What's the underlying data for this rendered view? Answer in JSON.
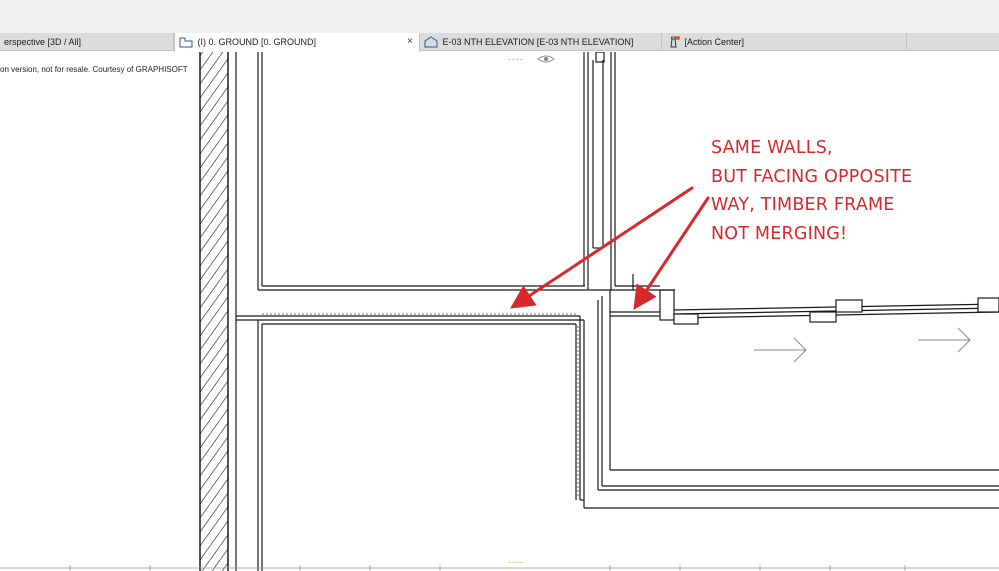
{
  "tabs": [
    {
      "label": "erspective [3D / All]",
      "icon": "perspective-icon",
      "active": false
    },
    {
      "label": "(I) 0. GROUND [0. GROUND]",
      "icon": "floor-plan-icon",
      "active": true
    },
    {
      "label": "E-03 NTH ELEVATION [E-03 NTH ELEVATION]",
      "icon": "elevation-icon",
      "active": false
    },
    {
      "label": "[Action Center]",
      "icon": "lighthouse-icon",
      "active": false
    }
  ],
  "close_symbol": "×",
  "courtesy_text": "on version, not for resale. Courtesy of GRAPHISOFT",
  "annotation": {
    "lines": [
      "SAME WALLS,",
      "BUT FACING OPPOSITE",
      "WAY, TIMBER FRAME",
      "NOT MERGING!"
    ],
    "color": "#d8282c"
  },
  "markers": {
    "top": "----",
    "bottom": "----"
  },
  "colors": {
    "tab_bar": "#dcdcdc",
    "active_tab": "#ffffff",
    "drawing_lines": "#1a1a1a",
    "accent": "#d8282c"
  }
}
